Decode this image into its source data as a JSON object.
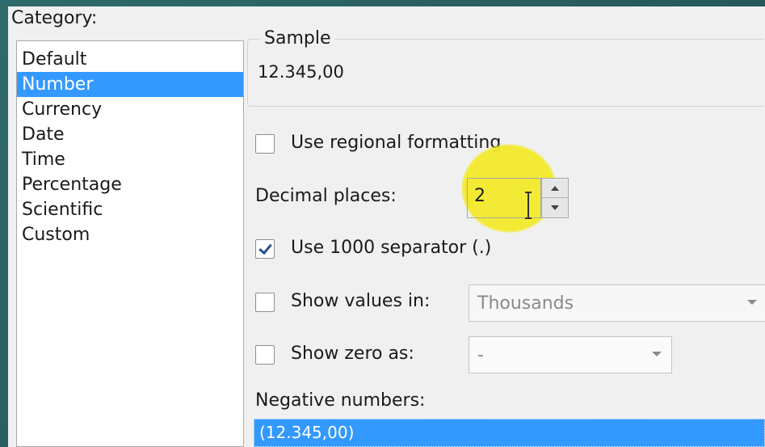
{
  "category": {
    "label": "Category:",
    "items": [
      {
        "label": "Default",
        "selected": false
      },
      {
        "label": "Number",
        "selected": true
      },
      {
        "label": "Currency",
        "selected": false
      },
      {
        "label": "Date",
        "selected": false
      },
      {
        "label": "Time",
        "selected": false
      },
      {
        "label": "Percentage",
        "selected": false
      },
      {
        "label": "Scientific",
        "selected": false
      },
      {
        "label": "Custom",
        "selected": false
      }
    ]
  },
  "sample": {
    "title": "Sample",
    "value": "12.345,00"
  },
  "regional": {
    "label": "Use regional formatting",
    "checked": false
  },
  "decimal": {
    "label": "Decimal places:",
    "value": "2"
  },
  "separator": {
    "label": "Use 1000 separator (.)",
    "checked": true
  },
  "show_values": {
    "label": "Show values in:",
    "checked": false,
    "selected": "Thousands"
  },
  "show_zero": {
    "label": "Show zero as:",
    "checked": false,
    "selected": "-"
  },
  "negative": {
    "label": "Negative numbers:",
    "items": [
      "(12.345,00)"
    ]
  },
  "colors": {
    "selection": "#3399ff",
    "highlight": "#f3ea2a",
    "dialog_bg": "#f0f0f0"
  },
  "icons": {
    "cursor": "text-cursor-icon",
    "spin_up": "spin-up-icon",
    "spin_down": "spin-down-icon",
    "dropdown": "chevron-down-icon"
  }
}
